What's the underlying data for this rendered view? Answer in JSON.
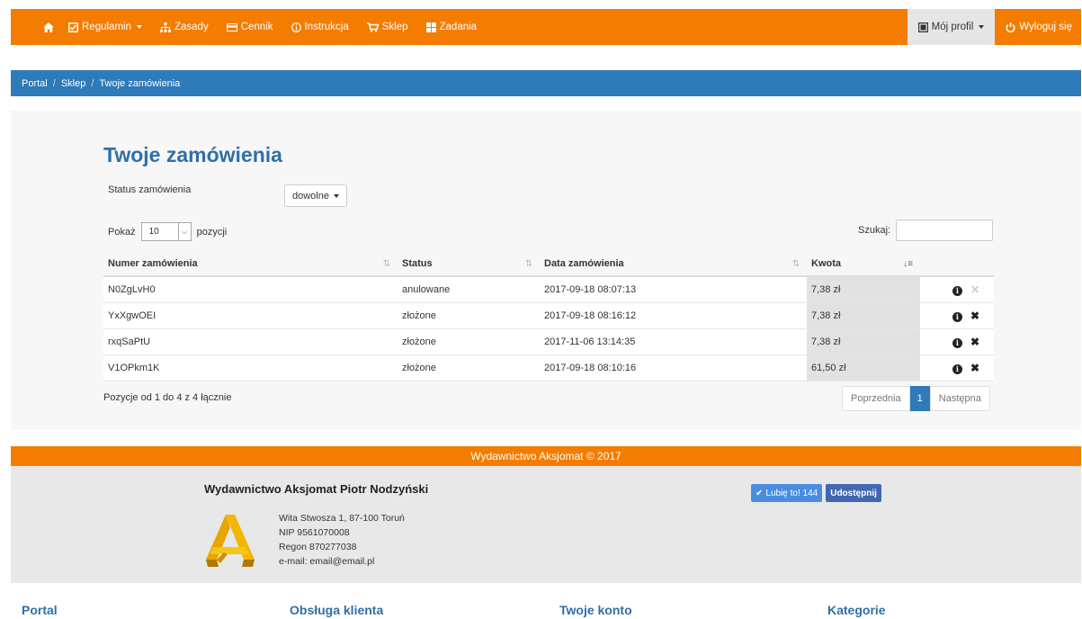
{
  "nav": {
    "items": [
      {
        "label": "Regulamin",
        "icon": "checkbox-icon",
        "dropdown": true
      },
      {
        "label": "Zasady",
        "icon": "sitemap-icon",
        "dropdown": false
      },
      {
        "label": "Cennik",
        "icon": "credit-card-icon",
        "dropdown": false
      },
      {
        "label": "Instrukcja",
        "icon": "info-icon",
        "dropdown": false
      },
      {
        "label": "Sklep",
        "icon": "cart-icon",
        "dropdown": false
      },
      {
        "label": "Zadania",
        "icon": "grid-icon",
        "dropdown": false
      }
    ],
    "profile": "Mój profil",
    "logout": "Wyloguj się"
  },
  "breadcrumb": [
    "Portal",
    "Sklep",
    "Twoje zamówienia"
  ],
  "page_title": "Twoje zamówienia",
  "filter": {
    "label": "Status zamówienia",
    "value": "dowolne"
  },
  "length": {
    "prefix": "Pokaż",
    "value": "10",
    "suffix": "pozycji"
  },
  "search": {
    "label": "Szukaj:",
    "value": ""
  },
  "table": {
    "headers": [
      "Numer zamówienia",
      "Status",
      "Data zamówienia",
      "Kwota"
    ],
    "rows": [
      {
        "number": "N0ZgLvH0",
        "status": "anulowane",
        "date": "2017-09-18 08:07:13",
        "amount": "7,38 zł",
        "cancel_enabled": false
      },
      {
        "number": "YxXgwOEI",
        "status": "złożone",
        "date": "2017-09-18 08:16:12",
        "amount": "7,38 zł",
        "cancel_enabled": true
      },
      {
        "number": "rxqSaPtU",
        "status": "złożone",
        "date": "2017-11-06 13:14:35",
        "amount": "7,38 zł",
        "cancel_enabled": true
      },
      {
        "number": "V1OPkm1K",
        "status": "złożone",
        "date": "2017-09-18 08:10:16",
        "amount": "61,50 zł",
        "cancel_enabled": true
      }
    ]
  },
  "table_info": "Pozycje od 1 do 4 z 4 łącznie",
  "pager": {
    "prev": "Poprzednia",
    "current": "1",
    "next": "Następna"
  },
  "footer": {
    "bar": "Wydawnictwo Aksjomat © 2017",
    "company": "Wydawnictwo Aksjomat Piotr Nodzyński",
    "address": [
      "Wita Stwosza 1, 87-100 Toruń",
      "NIP 9561070008",
      "Regon 870277038",
      "e-mail: email@email.pl"
    ],
    "like_label": "Lubię to! 144",
    "share_label": "Udostępnij",
    "columns": [
      "Portal",
      "Obsługa klienta",
      "Twoje konto",
      "Kategorie"
    ]
  },
  "colors": {
    "orange": "#f47c00",
    "blue": "#2f7ab9",
    "title_blue": "#2f6fa8",
    "facebook": "#4267b2"
  }
}
